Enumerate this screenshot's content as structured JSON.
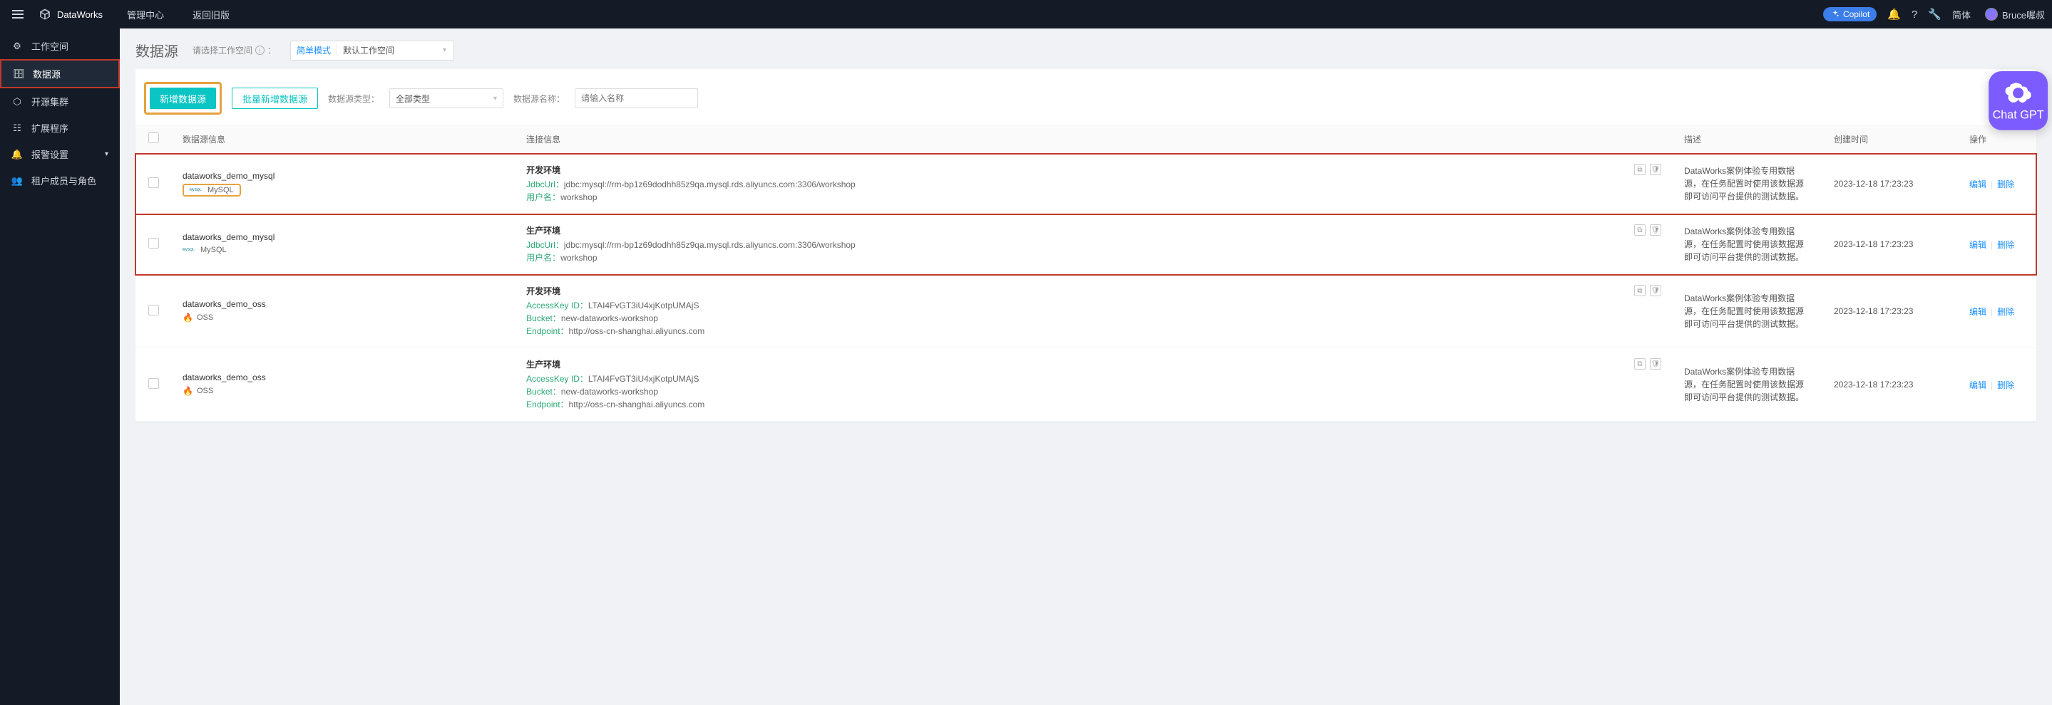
{
  "topbar": {
    "brand": "DataWorks",
    "nav1": "管理中心",
    "nav2": "返回旧版",
    "copilot": "Copilot",
    "lang": "简体",
    "user": "Bruce喔叔"
  },
  "sidebar": {
    "items": [
      {
        "label": "工作空间",
        "icon": "gear"
      },
      {
        "label": "数据源",
        "icon": "database"
      },
      {
        "label": "开源集群",
        "icon": "hexagon"
      },
      {
        "label": "扩展程序",
        "icon": "sliders"
      },
      {
        "label": "报警设置",
        "icon": "bell",
        "expandable": true
      },
      {
        "label": "租户成员与角色",
        "icon": "users"
      }
    ]
  },
  "page": {
    "title": "数据源",
    "ws_label": "请选择工作空间",
    "ws_mode": "简单模式",
    "ws_name": "默认工作空间"
  },
  "toolbar": {
    "add": "新增数据源",
    "batch_add": "批量新增数据源",
    "type_label": "数据源类型：",
    "type_value": "全部类型",
    "name_label": "数据源名称：",
    "name_placeholder": "请输入名称"
  },
  "table": {
    "headers": {
      "info": "数据源信息",
      "conn": "连接信息",
      "desc": "描述",
      "created": "创建时间",
      "ops": "操作"
    },
    "common": {
      "desc": "DataWorks案例体验专用数据源，在任务配置时使用该数据源即可访问平台提供的测试数据。",
      "created": "2023-12-18 17:23:23",
      "edit": "编辑",
      "delete": "删除"
    },
    "rows": [
      {
        "name": "dataworks_demo_mysql",
        "type": "MySQL",
        "type_hl": true,
        "env": "开发环境",
        "fields": [
          {
            "k": "JdbcUrl：",
            "v": "jdbc:mysql://rm-bp1z69dodhh85z9qa.mysql.rds.aliyuncs.com:3306/workshop"
          },
          {
            "k": "用户名：",
            "v": "workshop"
          }
        ],
        "hl": true
      },
      {
        "name": "dataworks_demo_mysql",
        "type": "MySQL",
        "type_hl": false,
        "env": "生产环境",
        "fields": [
          {
            "k": "JdbcUrl：",
            "v": "jdbc:mysql://rm-bp1z69dodhh85z9qa.mysql.rds.aliyuncs.com:3306/workshop"
          },
          {
            "k": "用户名：",
            "v": "workshop"
          }
        ],
        "hl": true
      },
      {
        "name": "dataworks_demo_oss",
        "type": "OSS",
        "type_hl": false,
        "env": "开发环境",
        "fields": [
          {
            "k": "AccessKey ID：",
            "v": "LTAI4FvGT3iU4xjKotpUMAjS"
          },
          {
            "k": "Bucket：",
            "v": "new-dataworks-workshop"
          },
          {
            "k": "Endpoint：",
            "v": "http://oss-cn-shanghai.aliyuncs.com"
          }
        ],
        "hl": false
      },
      {
        "name": "dataworks_demo_oss",
        "type": "OSS",
        "type_hl": false,
        "env": "生产环境",
        "fields": [
          {
            "k": "AccessKey ID：",
            "v": "LTAI4FvGT3iU4xjKotpUMAjS"
          },
          {
            "k": "Bucket：",
            "v": "new-dataworks-workshop"
          },
          {
            "k": "Endpoint：",
            "v": "http://oss-cn-shanghai.aliyuncs.com"
          }
        ],
        "hl": false
      }
    ]
  },
  "chatgpt": "Chat GPT"
}
